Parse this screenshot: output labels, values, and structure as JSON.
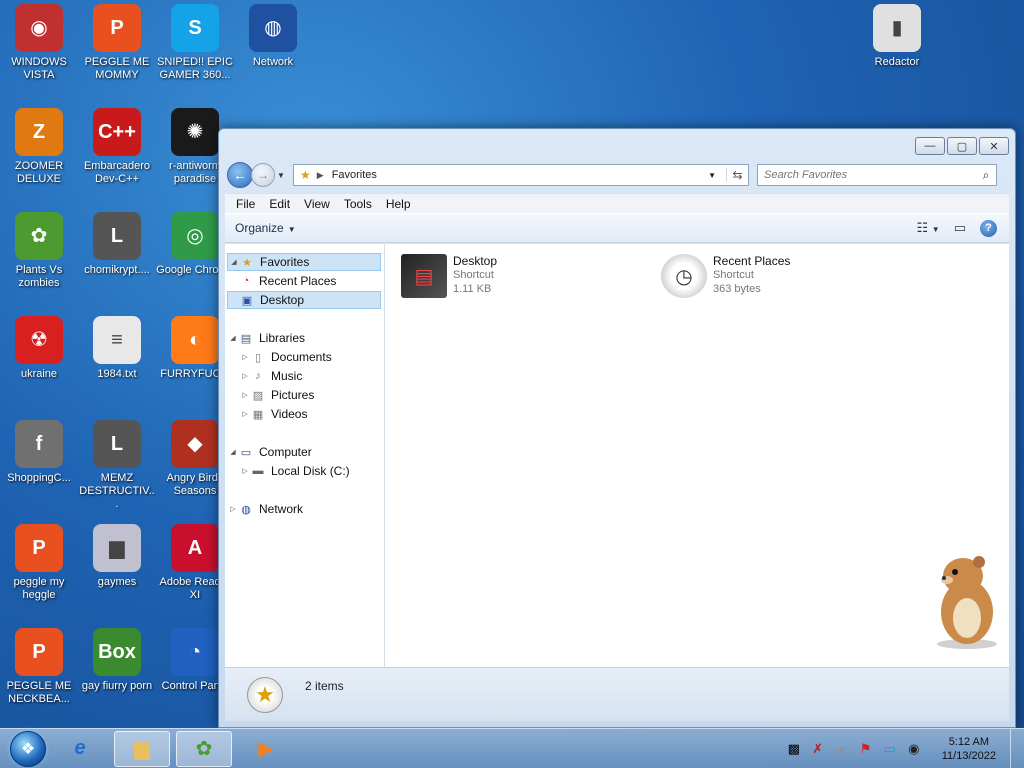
{
  "desktop": {
    "icons": [
      {
        "label": "WINDOWS VISTA",
        "icon": "vista-disc-icon",
        "color": "#c03030"
      },
      {
        "label": "PEGGLE ME MOMMY",
        "icon": "peggle-icon",
        "color": "#e85020"
      },
      {
        "label": "SNIPED!! EPIC GAMER 360...",
        "icon": "skype-icon",
        "color": "#14a3e8"
      },
      {
        "label": "Network",
        "icon": "network-globe-icon",
        "color": "#2050a0"
      },
      {
        "label": "Redactor",
        "icon": "document-icon",
        "color": "#e0e0e0"
      },
      {
        "label": "ZOOMER DELUXE",
        "icon": "zoomer-icon",
        "color": "#e07a10"
      },
      {
        "label": "Embarcadero Dev-C++",
        "icon": "devcpp-icon",
        "color": "#c81a1a"
      },
      {
        "label": "r-antiworm paradise",
        "icon": "antiworm-icon",
        "color": "#1a1a1a"
      },
      {
        "label": "Plants Vs zombies",
        "icon": "plant-icon",
        "color": "#4c9a30"
      },
      {
        "label": "chomikrypt....",
        "icon": "lock-file-icon",
        "color": "#555555"
      },
      {
        "label": "Google Chrome",
        "icon": "chrome-icon",
        "color": "#2f9b48"
      },
      {
        "label": "ukraine",
        "icon": "radiation-icon",
        "color": "#d82020"
      },
      {
        "label": "1984.txt",
        "icon": "text-file-icon",
        "color": "#e8e8e8"
      },
      {
        "label": "FURRYFUC...",
        "icon": "firefox-icon",
        "color": "#ff7a18"
      },
      {
        "label": "ShoppingC...",
        "icon": "flash-icon",
        "color": "#707070"
      },
      {
        "label": "MEMZ DESTRUCTIV...",
        "icon": "lock-file-icon",
        "color": "#555555"
      },
      {
        "label": "Angry Birds Seasons",
        "icon": "angry-birds-icon",
        "color": "#b03020"
      },
      {
        "label": "peggle my heggle",
        "icon": "peggle-icon",
        "color": "#e85020"
      },
      {
        "label": "gaymes",
        "icon": "folder-icon",
        "color": "#c0c0d0"
      },
      {
        "label": "Adobe Reader XI",
        "icon": "adobe-icon",
        "color": "#c8102e"
      },
      {
        "label": "PEGGLE ME NECKBEA...",
        "icon": "peggle-icon",
        "color": "#e85020"
      },
      {
        "label": "gay fiurry porn",
        "icon": "box-icon",
        "color": "#3a8a30"
      },
      {
        "label": "Control Panel",
        "icon": "control-panel-icon",
        "color": "#2060c0"
      }
    ]
  },
  "window": {
    "address": "Favorites",
    "search_placeholder": "Search Favorites",
    "controls": {
      "minimize": "—",
      "maximize": "▢",
      "close": "✕"
    },
    "menu": [
      "File",
      "Edit",
      "View",
      "Tools",
      "Help"
    ],
    "organize_label": "Organize",
    "nav": {
      "favorites": "Favorites",
      "recent_places": "Recent Places",
      "desktop": "Desktop",
      "libraries": "Libraries",
      "documents": "Documents",
      "music": "Music",
      "pictures": "Pictures",
      "videos": "Videos",
      "computer": "Computer",
      "local_disk": "Local Disk (C:)",
      "network": "Network"
    },
    "files": [
      {
        "name": "Desktop",
        "type": "Shortcut",
        "size": "1.11 KB"
      },
      {
        "name": "Recent Places",
        "type": "Shortcut",
        "size": "363 bytes"
      }
    ],
    "status_count": "2 items"
  },
  "taskbar": {
    "clock_time": "5:12 AM",
    "clock_date": "11/13/2022"
  }
}
